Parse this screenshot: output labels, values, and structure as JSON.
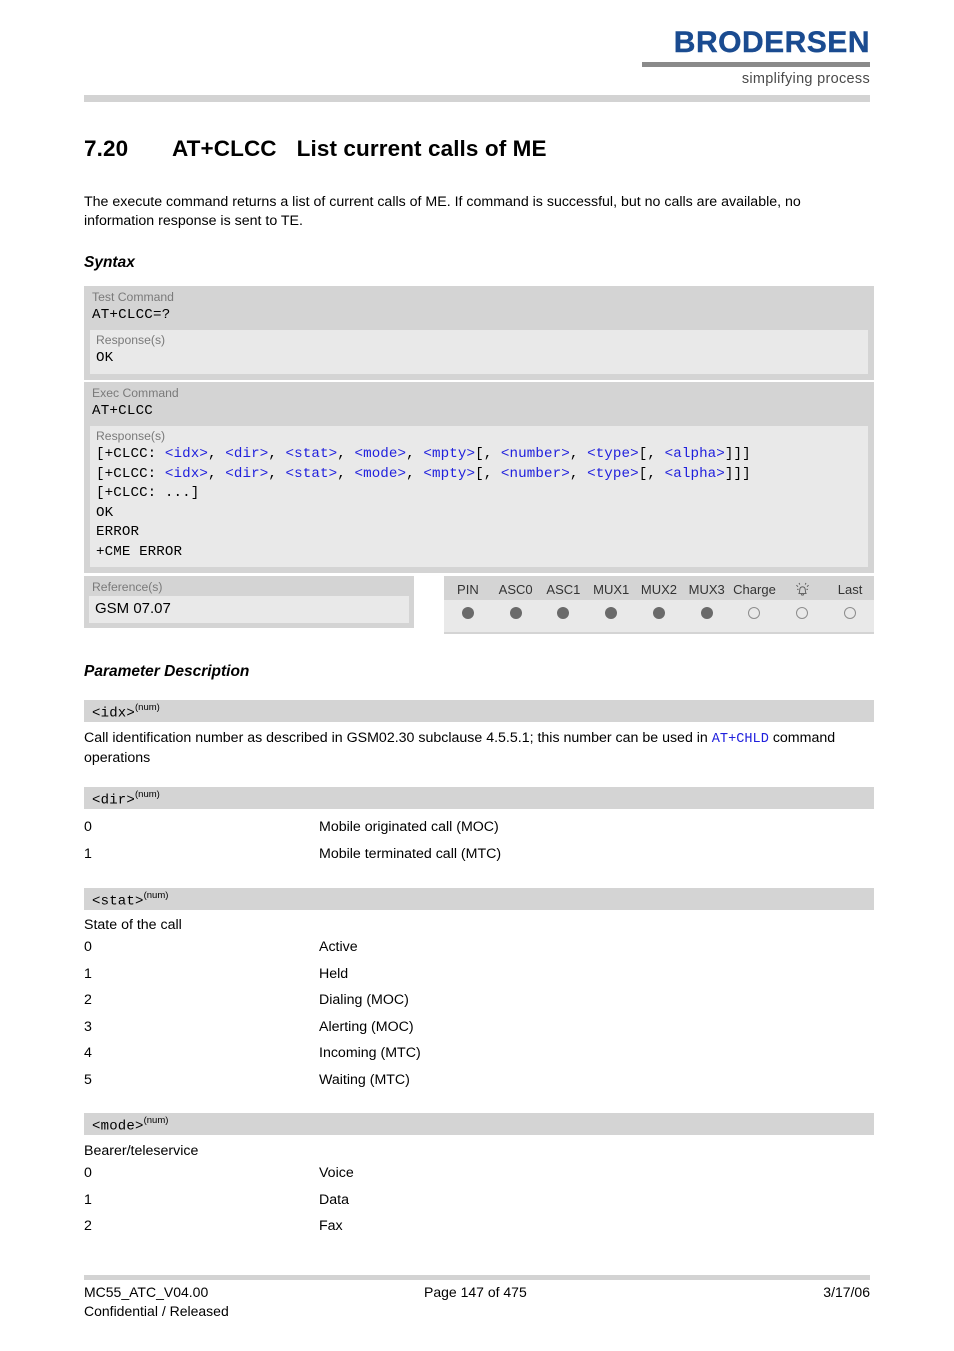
{
  "header": {
    "logo_word": "BRODERSEN",
    "logo_tagline": "simplifying process",
    "brand_color": "#1a4b90"
  },
  "title": {
    "number": "7.20",
    "command": "AT+CLCC",
    "description": "List current calls of ME"
  },
  "intro": "The execute command returns a list of current calls of ME. If command is successful, but no calls are available, no information response is sent to TE.",
  "headings": {
    "syntax": "Syntax",
    "parameter_description": "Parameter Description"
  },
  "syntax": {
    "test": {
      "label": "Test Command",
      "command": "AT+CLCC=?",
      "response_label": "Response(s)",
      "response_lines": [
        "OK"
      ]
    },
    "exec": {
      "label": "Exec Command",
      "command": "AT+CLCC",
      "response_label": "Response(s)",
      "line1_prefix": "[+CLCC: ",
      "line_params": [
        "<idx>",
        "<dir>",
        "<stat>",
        "<mode>",
        "<mpty>",
        "<number>",
        "<type>",
        "<alpha>"
      ],
      "line3": "[+CLCC: ...]",
      "line4": "OK",
      "line5": "ERROR",
      "line6": "+CME ERROR"
    }
  },
  "reference": {
    "label": "Reference(s)",
    "value": "GSM 07.07"
  },
  "indicators": {
    "columns": [
      "PIN",
      "ASC0",
      "ASC1",
      "MUX1",
      "MUX2",
      "MUX3",
      "Charge",
      "alarm-icon",
      "Last"
    ],
    "states": [
      "on",
      "on",
      "on",
      "on",
      "on",
      "on",
      "off",
      "off",
      "off"
    ]
  },
  "parameters": [
    {
      "name": "<idx>",
      "type": "(num)",
      "freetext_before": "Call identification number as described in GSM02.30 subclause 4.5.5.1; this number can be used in ",
      "link": "AT+CHLD",
      "freetext_after": " command operations",
      "values": []
    },
    {
      "name": "<dir>",
      "type": "(num)",
      "description": "",
      "values": [
        {
          "key": "0",
          "val": "Mobile originated call (MOC)"
        },
        {
          "key": "1",
          "val": "Mobile terminated call (MTC)"
        }
      ]
    },
    {
      "name": "<stat>",
      "type": "(num)",
      "description": "State of the call",
      "values": [
        {
          "key": "0",
          "val": "Active"
        },
        {
          "key": "1",
          "val": "Held"
        },
        {
          "key": "2",
          "val": "Dialing (MOC)"
        },
        {
          "key": "3",
          "val": "Alerting (MOC)"
        },
        {
          "key": "4",
          "val": "Incoming (MTC)"
        },
        {
          "key": "5",
          "val": "Waiting (MTC)"
        }
      ]
    },
    {
      "name": "<mode>",
      "type": "(num)",
      "description": "Bearer/teleservice",
      "values": [
        {
          "key": "0",
          "val": "Voice"
        },
        {
          "key": "1",
          "val": "Data"
        },
        {
          "key": "2",
          "val": "Fax"
        }
      ]
    }
  ],
  "footer": {
    "document": "MC55_ATC_V04.00",
    "classification": "Confidential / Released",
    "page": "Page 147 of 475",
    "date": "3/17/06"
  }
}
